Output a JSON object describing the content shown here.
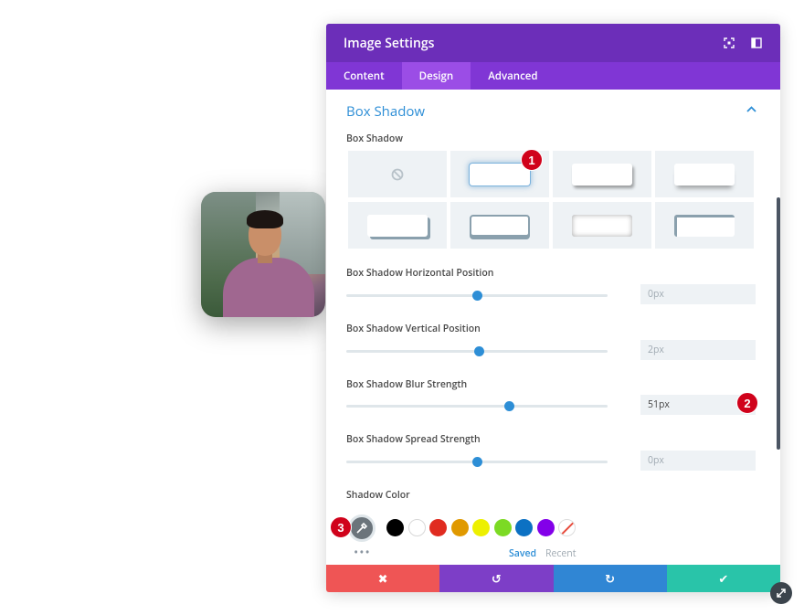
{
  "modal": {
    "title": "Image Settings",
    "tabs": [
      "Content",
      "Design",
      "Advanced"
    ],
    "active_tab": "Design"
  },
  "section": {
    "title": "Box Shadow",
    "box_shadow_label": "Box Shadow",
    "preset_count": 8,
    "selected_preset": 1
  },
  "sliders": [
    {
      "label": "Box Shadow Horizontal Position",
      "value": "0px",
      "fraction": 0.5
    },
    {
      "label": "Box Shadow Vertical Position",
      "value": "2px",
      "fraction": 0.51
    },
    {
      "label": "Box Shadow Blur Strength",
      "value": "51px",
      "fraction": 0.63
    },
    {
      "label": "Box Shadow Spread Strength",
      "value": "0px",
      "fraction": 0.5
    }
  ],
  "shadow_color": {
    "label": "Shadow Color",
    "swatches": [
      "#000000",
      "#ffffff",
      "#e02b20",
      "#e09900",
      "#edf000",
      "#7cda24",
      "#0c71c3",
      "#8300e9",
      "none"
    ],
    "saved_label": "Saved",
    "recent_label": "Recent",
    "more": "•••"
  },
  "badges": [
    "1",
    "2",
    "3"
  ],
  "footer": {
    "cancel": "✖",
    "undo": "↺",
    "redo": "↻",
    "save": "✔"
  }
}
